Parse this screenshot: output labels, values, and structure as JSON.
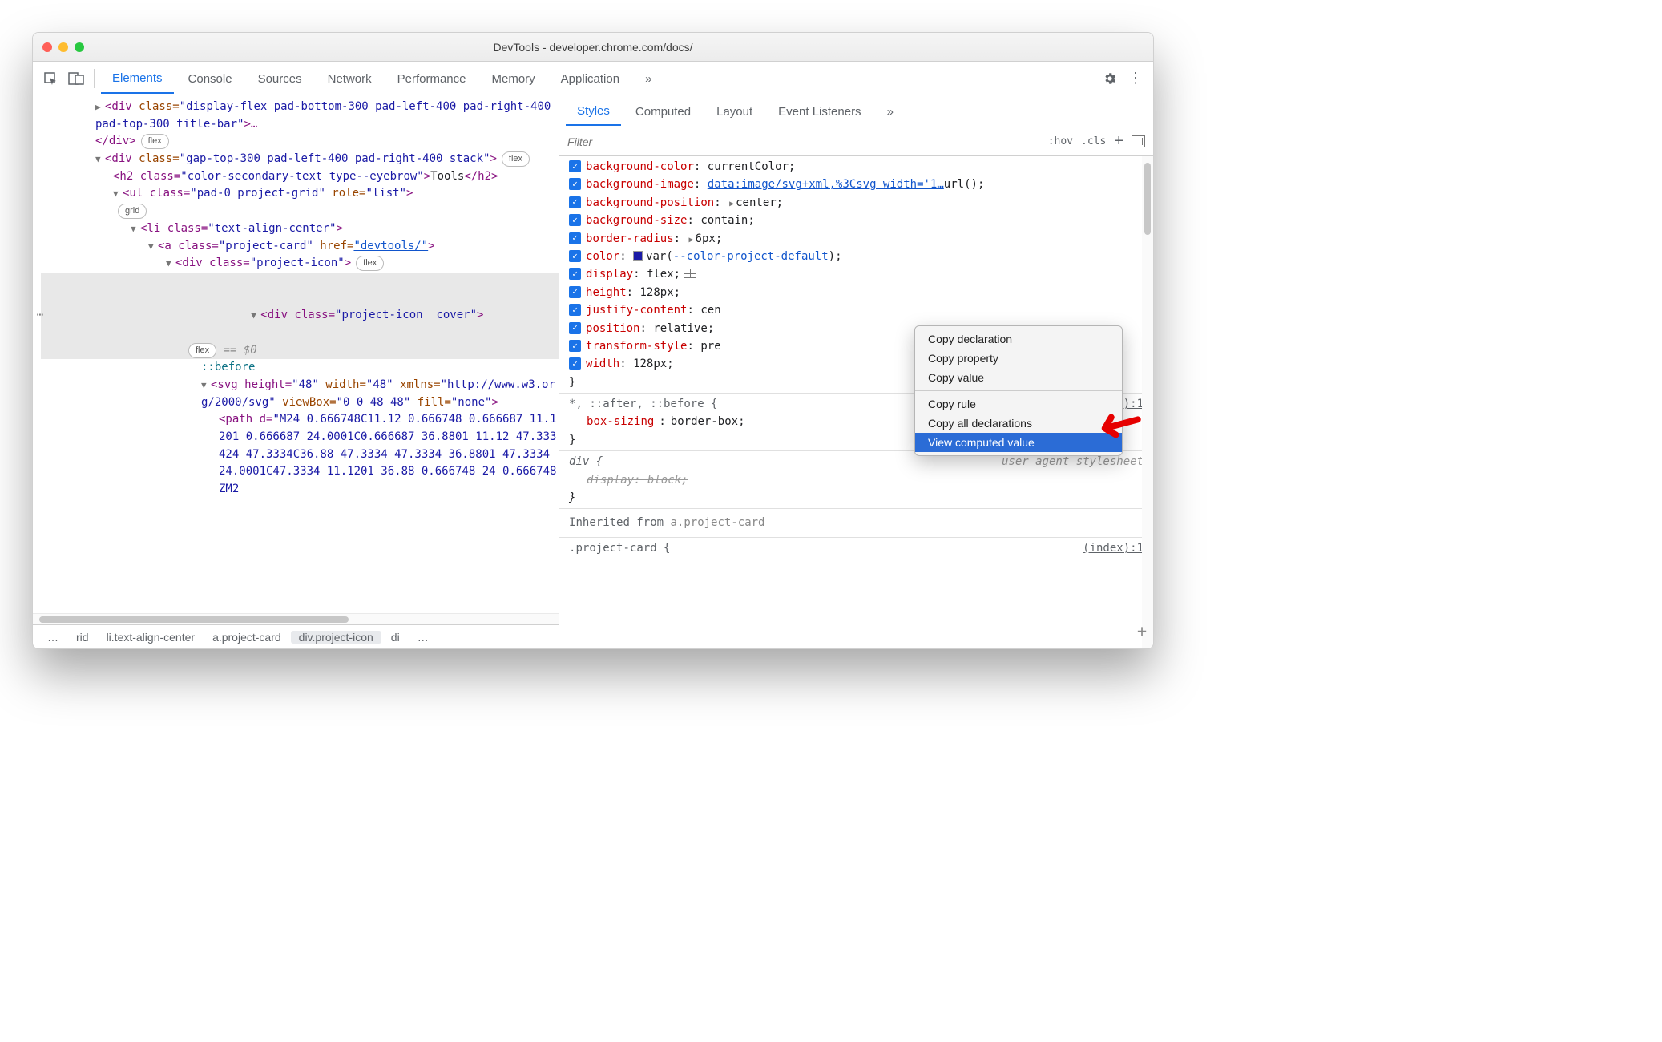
{
  "window_title": "DevTools - developer.chrome.com/docs/",
  "main_tabs": [
    "Elements",
    "Console",
    "Sources",
    "Network",
    "Performance",
    "Memory",
    "Application"
  ],
  "main_tabs_overflow": "»",
  "sub_tabs": [
    "Styles",
    "Computed",
    "Layout",
    "Event Listeners"
  ],
  "sub_tabs_overflow": "»",
  "filter_placeholder": "Filter",
  "filter_hov": ":hov",
  "filter_cls": ".cls",
  "dom": {
    "l0a_tag_open": "<div",
    "l0a_class_attr": " class=",
    "l0a_class_val": "\"display-flex pad-bottom-300 pad-left-400 pad-right-400 pad-top-300 title-bar\"",
    "l0a_close": ">…",
    "l0b": "</div>",
    "l0b_pill": "flex",
    "l1_tag_open": "<div",
    "l1_class_val": "\"gap-top-300 pad-left-400 pad-right-400 stack\"",
    "l1_close": ">",
    "l1_pill": "flex",
    "l2_open": "<h2 class=",
    "l2_class_val": "\"color-secondary-text type--eyebrow\"",
    "l2_close": ">",
    "l2_text": "Tools",
    "l2_end": "</h2>",
    "l3_open": "<ul class=",
    "l3_class_val": "\"pad-0 project-grid\"",
    "l3_role": " role=",
    "l3_role_val": "\"list\"",
    "l3_close": ">",
    "l3_pill": "grid",
    "l4_open": "<li class=",
    "l4_class_val": "\"text-align-center\"",
    "l4_close": ">",
    "l5_open": "<a class=",
    "l5_class_val": "\"project-card\"",
    "l5_href": " href=",
    "l5_href_val": "\"devtools/\"",
    "l5_close": ">",
    "l6_open": "<div class=",
    "l6_class_val": "\"project-icon\"",
    "l6_close": ">",
    "l6_pill": "flex",
    "l7_open": "<div class=",
    "l7_class_val": "\"project-icon__cover\"",
    "l7_close": ">",
    "l7_pill": "flex",
    "l7_eq": " == $0",
    "l8": "::before",
    "l9_open": "<svg height=",
    "l9_h": "\"48\"",
    "l9_w_attr": " width=",
    "l9_w": "\"48\"",
    "l9_xmlns_attr": " xmlns=",
    "l9_xmlns": "\"http://www.w3.org/2000/svg\"",
    "l9_vb_attr": " viewBox=",
    "l9_vb": "\"0 0 48 48\"",
    "l9_fill_attr": " fill=",
    "l9_fill": "\"none\"",
    "l9_close": ">",
    "l10_open": "<path d=",
    "l10_d": "\"M24 0.666748C11.12 0.666748 0.666687 11.1201 0.666687 24.0001C0.666687 36.8801 11.12 47.333424 47.3334C36.88 47.3334 47.3334 36.8801 47.3334 24.0001C47.3334 11.1201 36.88 0.666748 24 0.666748ZM2"
  },
  "crumbs": [
    "…",
    "rid",
    "li.text-align-center",
    "a.project-card",
    "div.project-icon",
    "di",
    "…"
  ],
  "crumb_selected_index": 4,
  "styles": {
    "rule1": [
      {
        "prop": "background-color",
        "val": "currentColor;",
        "partial": true
      },
      {
        "prop": "background-image",
        "val": "url(",
        "link": "data:image/svg+xml,%3Csvg width='1…",
        "tail": ");"
      },
      {
        "prop": "background-position",
        "val": "center;",
        "tri": true
      },
      {
        "prop": "background-size",
        "val": "contain;"
      },
      {
        "prop": "border-radius",
        "val": "6px;",
        "tri": true
      },
      {
        "prop": "color",
        "swatch": true,
        "pre": "var(",
        "link": "--color-project-default",
        "tail": ");"
      },
      {
        "prop": "display",
        "val": "flex;",
        "gridicon": true
      },
      {
        "prop": "height",
        "val": "128px;"
      },
      {
        "prop": "justify-content",
        "val": "cen"
      },
      {
        "prop": "position",
        "val": "relative;"
      },
      {
        "prop": "transform-style",
        "val": "pre"
      },
      {
        "prop": "width",
        "val": "128px;"
      }
    ],
    "rule1_close": "}",
    "rule2_sel": "*, ::after, ::before {",
    "rule2_origin": "(index):1",
    "rule2_decl_prop": "box-sizing",
    "rule2_decl_val": "border-box;",
    "rule2_close": "}",
    "rule3_sel": "div {",
    "rule3_ua": "user agent stylesheet",
    "rule3_decl": "display: block;",
    "rule3_close": "}",
    "inherited_label": "Inherited from ",
    "inherited_sel": "a.project-card",
    "rule4_sel": ".project-card {",
    "rule4_origin": "(index):1"
  },
  "ctx_menu": [
    "Copy declaration",
    "Copy property",
    "Copy value",
    "Copy rule",
    "Copy all declarations",
    "View computed value"
  ],
  "ctx_menu_selected": 5
}
